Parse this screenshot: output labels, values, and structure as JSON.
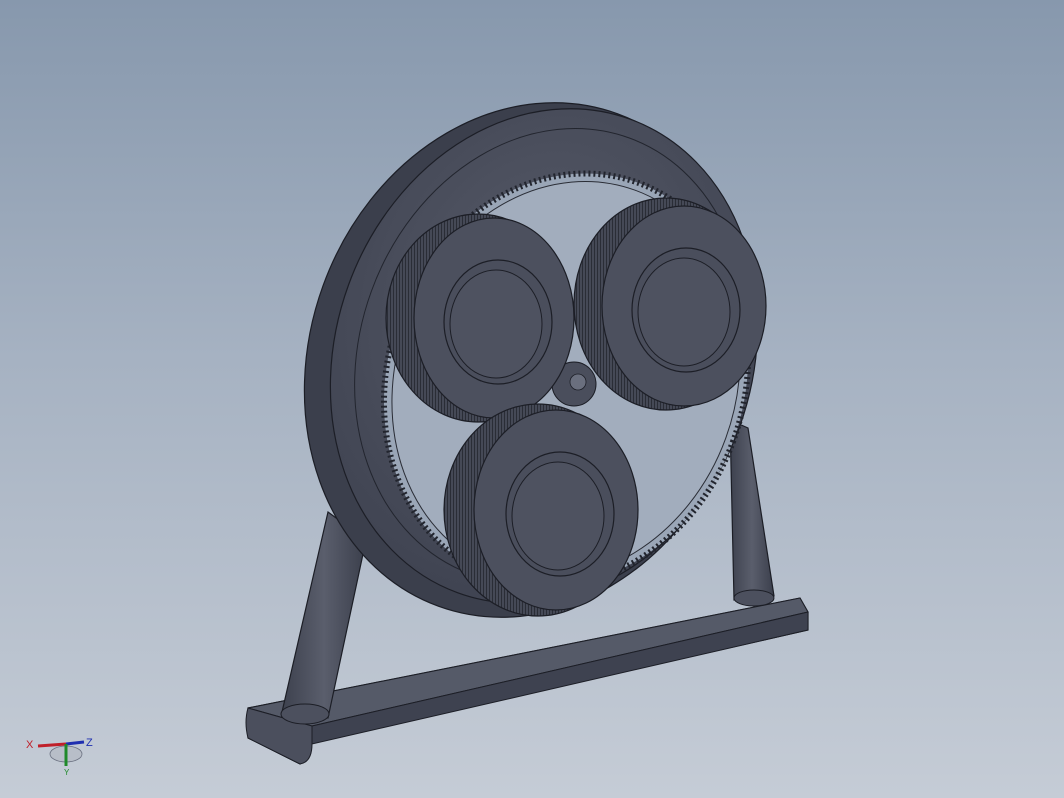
{
  "viewport": {
    "model_name": "planetary-gear-assembly",
    "background_top": "#8798ad",
    "background_bottom": "#c5ccd6",
    "model_color": "#4a4e5c",
    "edge_color": "#1c1e26"
  },
  "triad": {
    "x_label": "X",
    "y_label": "Y",
    "z_label": "Z",
    "x_color": "#c0202a",
    "y_color": "#1f8a2a",
    "z_color": "#1f2fb0"
  }
}
